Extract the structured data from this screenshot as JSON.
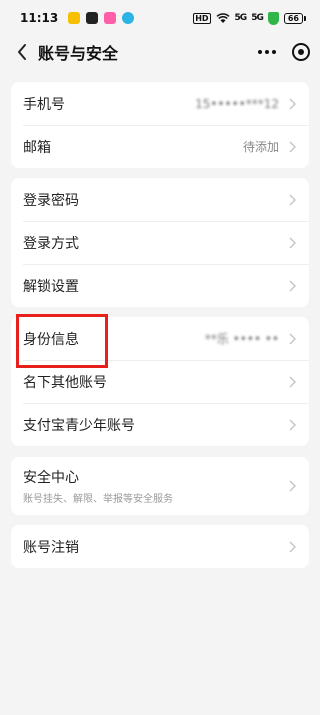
{
  "status_bar": {
    "time": "11:13",
    "hd_label": "HD",
    "signal1": "5G",
    "signal2": "5G",
    "battery": "66"
  },
  "nav": {
    "title": "账号与安全"
  },
  "groups": {
    "contact": {
      "phone": {
        "label": "手机号",
        "value": "15•••••***12"
      },
      "email": {
        "label": "邮箱",
        "value": "待添加"
      }
    },
    "login": {
      "password": {
        "label": "登录密码"
      },
      "method": {
        "label": "登录方式"
      },
      "unlock": {
        "label": "解锁设置"
      }
    },
    "identity": {
      "info": {
        "label": "身份信息",
        "value": "**乐 •••• ••"
      },
      "other_accounts": {
        "label": "名下其他账号"
      },
      "youth": {
        "label": "支付宝青少年账号"
      }
    },
    "security": {
      "title": "安全中心",
      "subtitle": "账号挂失、解限、举报等安全服务"
    },
    "cancel": {
      "label": "账号注销"
    }
  },
  "colors": {
    "background": "#f4f4f4",
    "card": "#ffffff",
    "highlight": "#e8201c",
    "secure_shield": "#2fb548"
  }
}
